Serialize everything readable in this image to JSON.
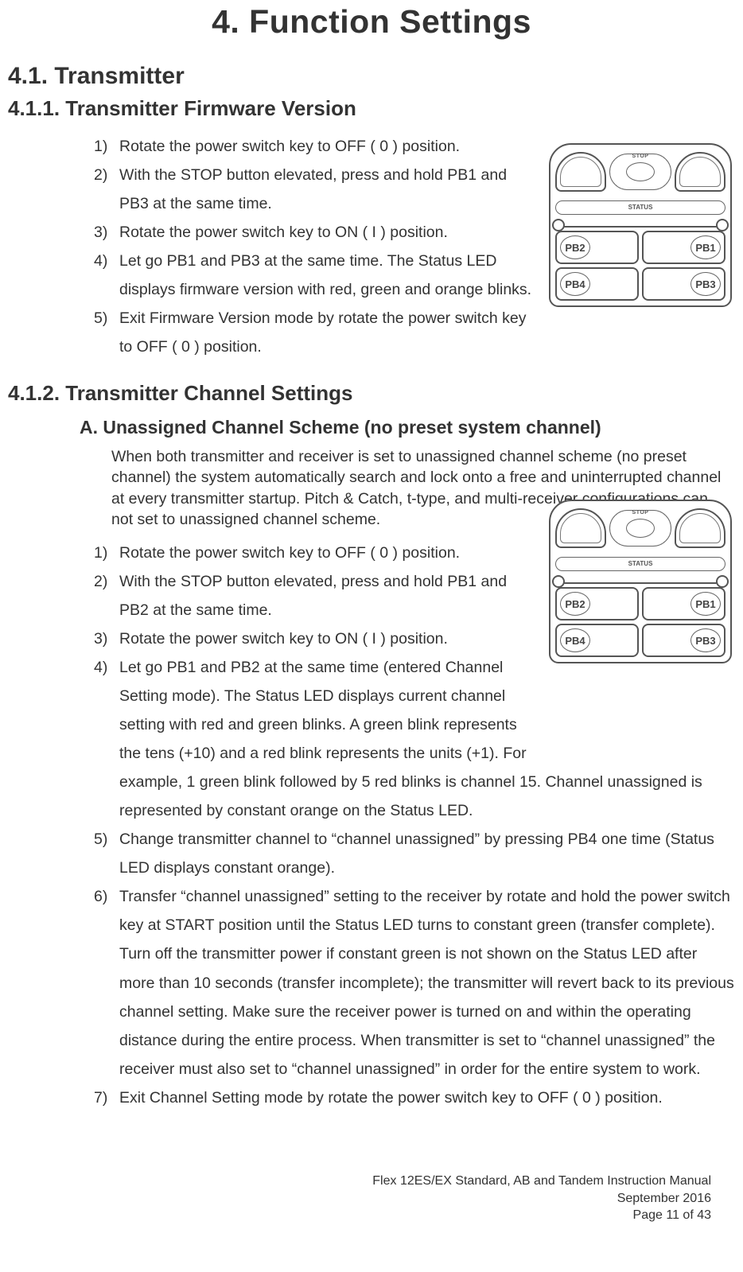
{
  "chapter": {
    "title": "4. Function Settings"
  },
  "s41": {
    "title": "4.1. Transmitter"
  },
  "s411": {
    "title": "4.1.1. Transmitter Firmware Version",
    "steps": {
      "n1": "1)",
      "t1": "Rotate the power switch key to OFF ( 0 ) position.",
      "n2": "2)",
      "t2": "With the STOP button elevated, press and hold PB1 and PB3 at the same time.",
      "n3": "3)",
      "t3": "Rotate the power switch key to ON ( I ) position.",
      "n4": "4)",
      "t4": "Let go PB1 and PB3 at the same time.  The Status LED displays firmware version with red, green and orange blinks.",
      "n5": "5)",
      "t5": "Exit Firmware Version mode by rotate the power switch key to OFF ( 0 ) position."
    }
  },
  "s412": {
    "title": "4.1.2. Transmitter Channel Settings",
    "A": {
      "title": "A. Unassigned Channel Scheme (no preset system channel)",
      "intro": "When both transmitter and receiver is set to unassigned channel scheme (no preset channel) the system automatically search and lock onto a free and uninterrupted channel at every transmitter startup.  Pitch & Catch, t-type, and multi-receiver configurations can not set to unassigned channel scheme.",
      "steps": {
        "n1": "1)",
        "t1": "Rotate the power switch key to OFF ( 0 ) position.",
        "n2": "2)",
        "t2": "With the STOP button elevated, press and hold PB1 and PB2 at the same time.",
        "n3": "3)",
        "t3": "Rotate the power switch key to ON ( I ) position.",
        "n4": "4)",
        "t4a": "Let go PB1 and PB2 at the same time (entered Channel Setting mode).  The Status LED displays current channel setting with red and green blinks.  A green blink represents the tens (+10) and a red blink represents the units (+1).  For ",
        "t4b": "example, 1 green blink followed by 5 red blinks is channel 15.  Channel unassigned is represented by constant orange on the Status LED.",
        "n5": "5)",
        "t5": "Change transmitter channel to “channel unassigned” by pressing PB4 one time (Status LED displays constant orange).",
        "n6": "6)",
        "t6": "Transfer “channel unassigned” setting to the receiver by rotate and hold the power switch key at START position until the Status LED turns to constant green (transfer complete).  Turn off the transmitter power if constant green is not shown on the Status LED after more than 10 seconds (transfer incomplete); the transmitter will revert back to its previous channel setting.  Make sure the receiver power is turned on and within the operating distance during the entire process.  When transmitter is set to “channel unassigned” the receiver must also set to “channel unassigned” in order for the entire system to work.",
        "n7": "7)",
        "t7": "Exit Channel Setting mode by rotate the power switch key to OFF ( 0 ) position."
      }
    }
  },
  "device": {
    "stop": "STOP",
    "status": "STATUS",
    "pb1": "PB1",
    "pb2": "PB2",
    "pb3": "PB3",
    "pb4": "PB4"
  },
  "footer": {
    "line1": "Flex 12ES/EX Standard, AB and Tandem Instruction Manual",
    "line2": "September 2016",
    "line3": "Page 11 of 43"
  }
}
